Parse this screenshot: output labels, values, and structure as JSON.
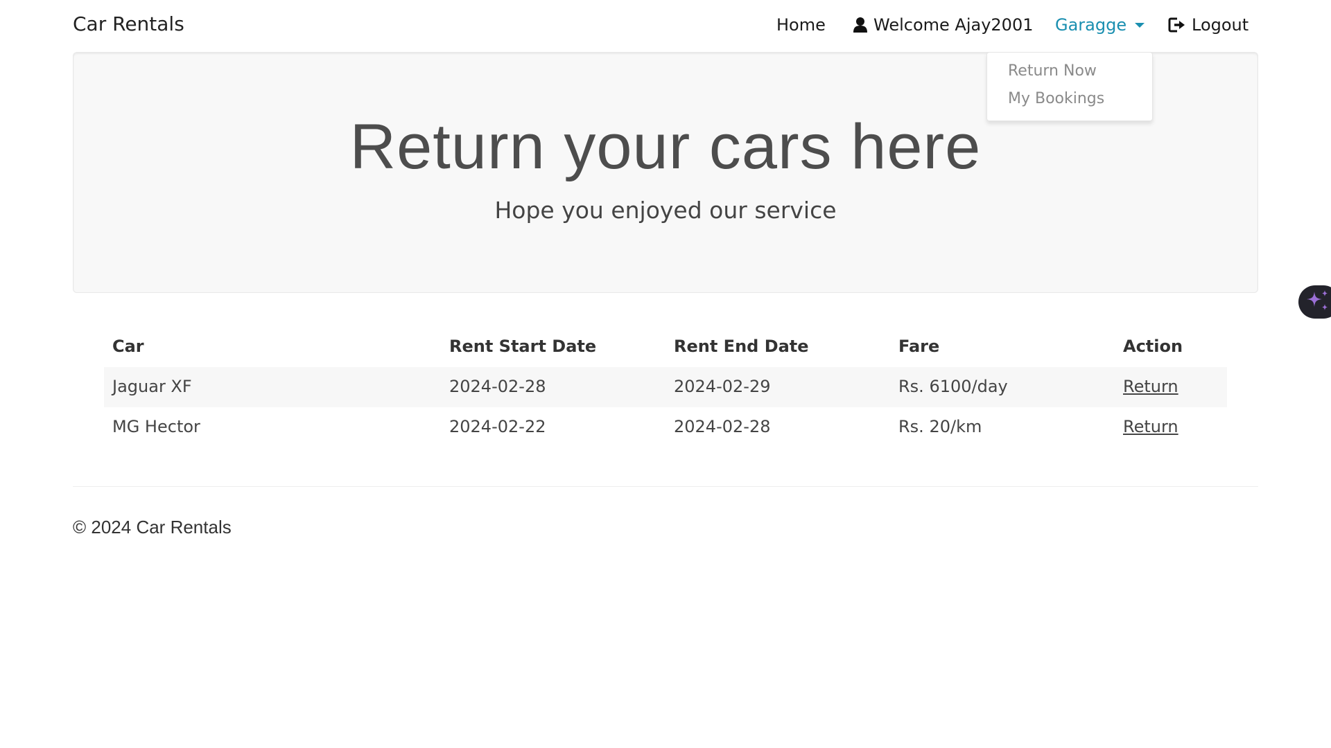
{
  "navbar": {
    "brand": "Car Rentals",
    "home": "Home",
    "welcome": "Welcome Ajay2001",
    "garage": "Garagge",
    "logout": "Logout"
  },
  "dropdown": {
    "items": [
      "Return Now",
      "My Bookings"
    ]
  },
  "hero": {
    "title": "Return your cars here",
    "subtitle": "Hope you enjoyed our service"
  },
  "table": {
    "headers": [
      "Car",
      "Rent Start Date",
      "Rent End Date",
      "Fare",
      "Action"
    ],
    "rows": [
      [
        "Jaguar XF",
        "2024-02-28",
        "2024-02-29",
        "Rs. 6100/day",
        "Return"
      ],
      [
        "MG Hector",
        "2024-02-22",
        "2024-02-28",
        "Rs. 20/km",
        "Return"
      ]
    ]
  },
  "footer": {
    "text": "© 2024 Car Rentals"
  },
  "colors": {
    "accent": "#1a8fb0",
    "jumbotron_bg": "#f8f8f8",
    "fab_bg": "#23232b",
    "fab_icon": "#9b6fd6"
  },
  "icons": {
    "user": "user-icon",
    "logout": "logout-icon",
    "fab": "sparkle-icon"
  }
}
